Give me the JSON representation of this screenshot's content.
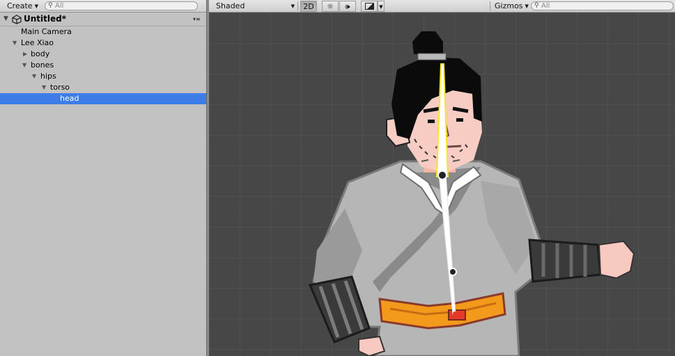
{
  "hierarchy": {
    "create_label": "Create",
    "search_placeholder": "All",
    "scene_name": "Untitled*",
    "items": [
      {
        "label": "Main Camera",
        "depth": 1,
        "arrow": ""
      },
      {
        "label": "Lee Xiao",
        "depth": 1,
        "arrow": "▼"
      },
      {
        "label": "body",
        "depth": 2,
        "arrow": "▶"
      },
      {
        "label": "bones",
        "depth": 2,
        "arrow": "▼"
      },
      {
        "label": "hips",
        "depth": 3,
        "arrow": "▼"
      },
      {
        "label": "torso",
        "depth": 4,
        "arrow": "▼"
      },
      {
        "label": "head",
        "depth": 5,
        "arrow": ""
      }
    ],
    "selected": "head"
  },
  "scene": {
    "shading_mode": "Shaded",
    "mode_2d_label": "2D",
    "gizmos_label": "Gizmos",
    "search_placeholder": "All",
    "colors": {
      "background": "#474747",
      "grid": "#5a5a5a",
      "selected_bone": "#f5e62a",
      "bone": "#ffffff",
      "selection": "#3e7de7"
    }
  }
}
